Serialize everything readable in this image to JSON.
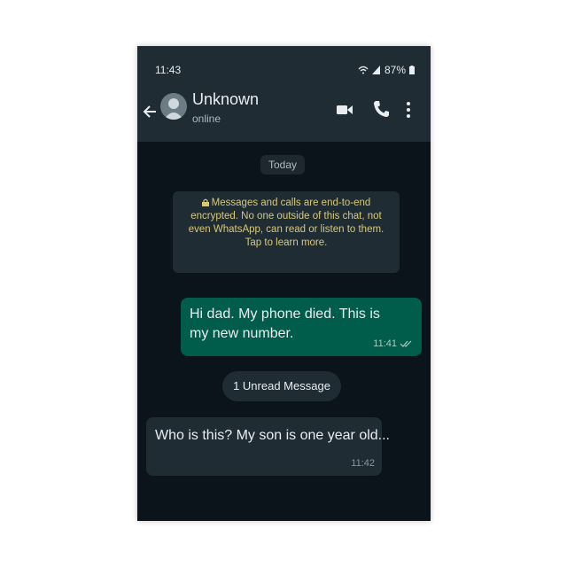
{
  "status_bar": {
    "time": "11:43",
    "battery": "87%"
  },
  "header": {
    "contact_name": "Unknown",
    "contact_status": "online",
    "icons": [
      "back-arrow-icon",
      "avatar",
      "video-call-icon",
      "phone-call-icon",
      "more-vert-icon"
    ]
  },
  "chat": {
    "date_label": "Today",
    "encryption_notice": "Messages and calls are end-to-end encrypted. No one outside of this chat, not even WhatsApp, can read or listen to them. Tap to learn more.",
    "messages": [
      {
        "direction": "outgoing",
        "text": "Hi dad. My phone died. This is my new number.",
        "time": "11:41"
      },
      {
        "direction": "incoming",
        "text": "Who is this? My son is one year old...",
        "time": "11:42"
      }
    ],
    "unread_label": "1 Unread Message"
  },
  "colors": {
    "background": "#0b141a",
    "header": "#1f2c34",
    "outgoing_bubble": "#005c4b",
    "incoming_bubble": "#1f2c34",
    "notice_text": "#d7c97a"
  }
}
